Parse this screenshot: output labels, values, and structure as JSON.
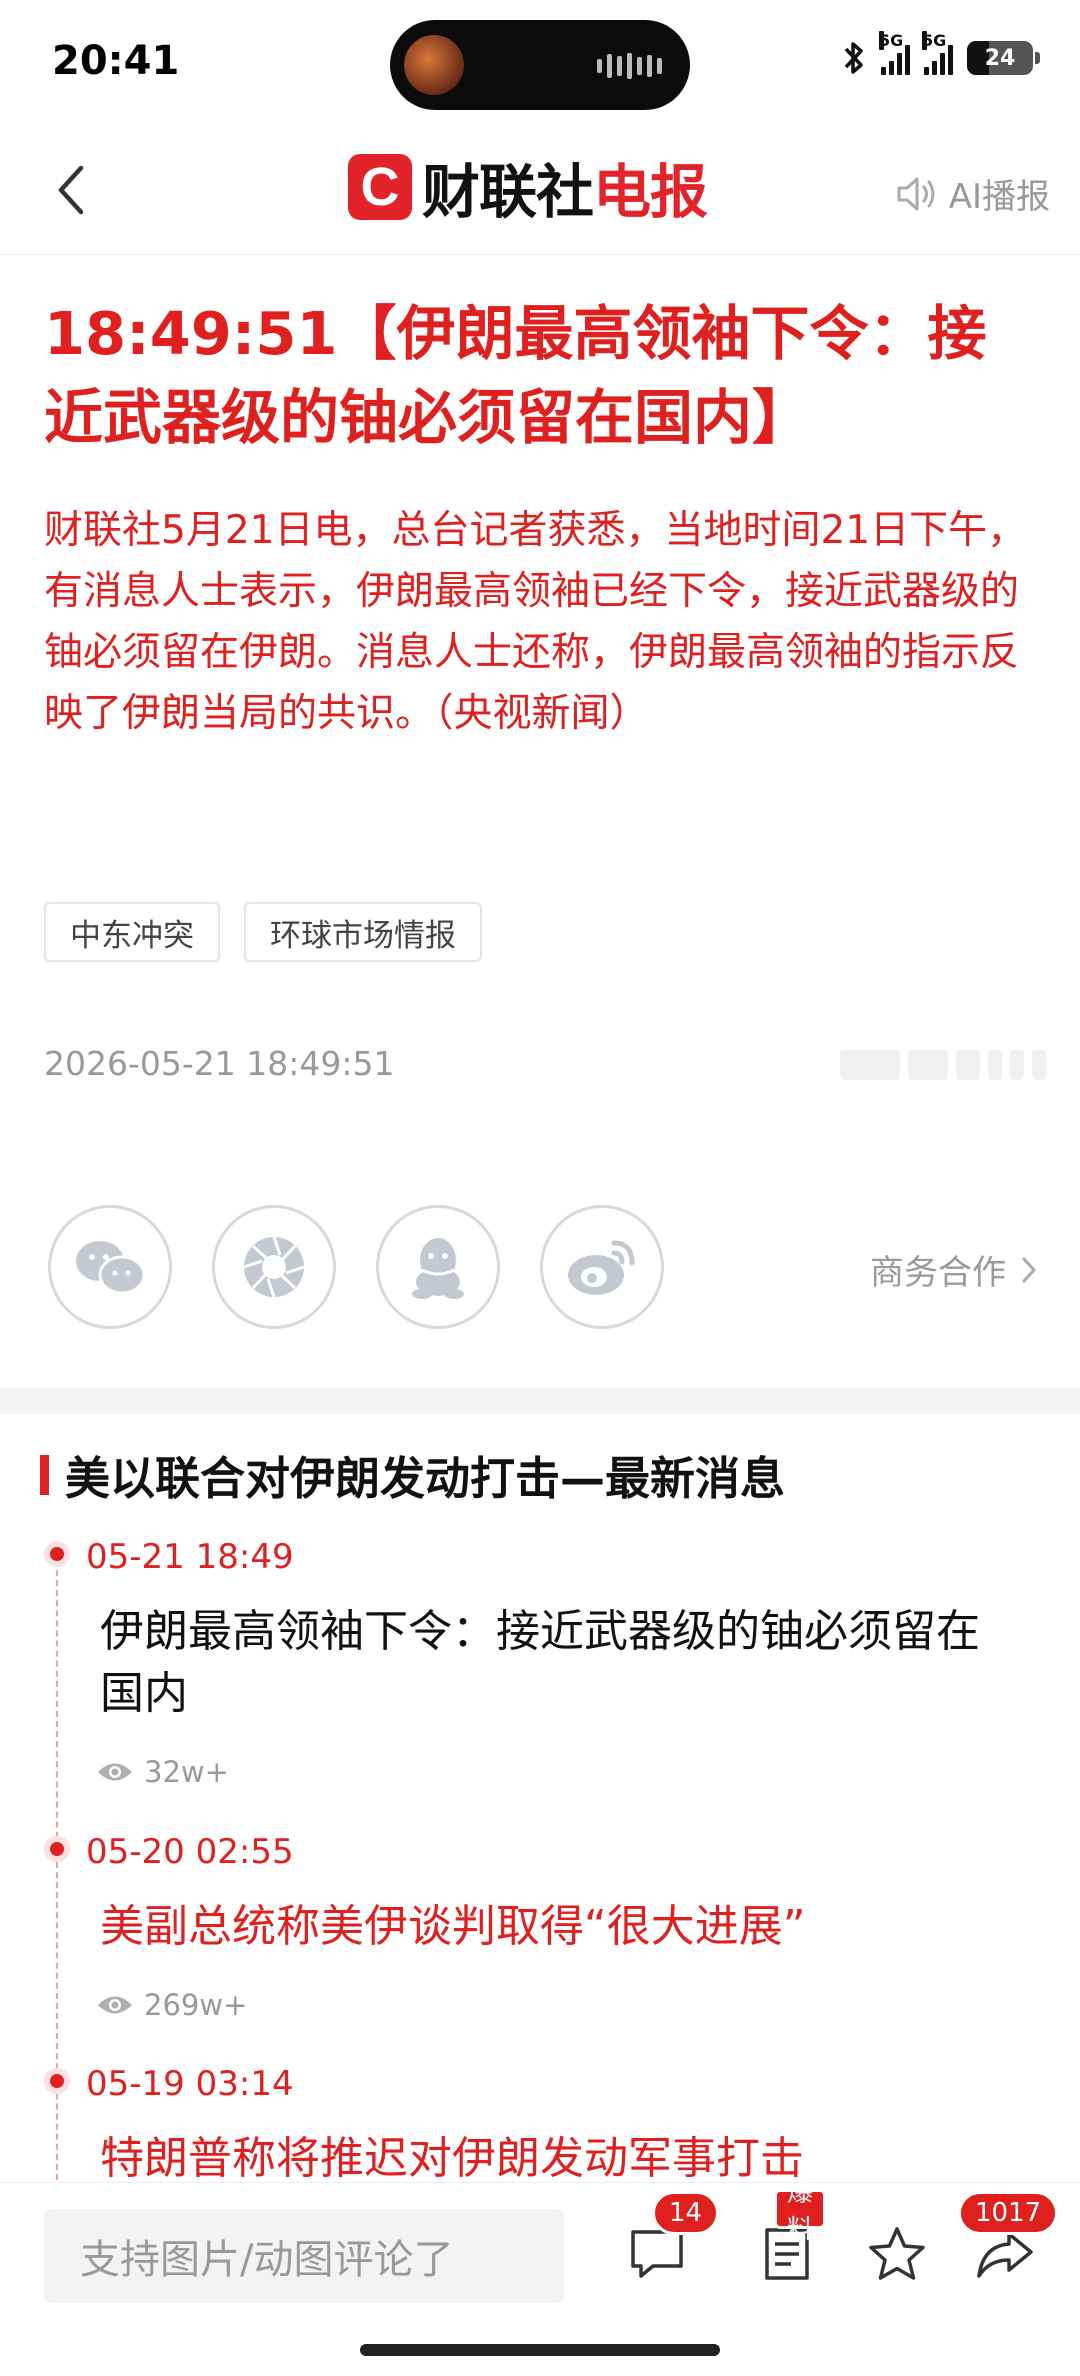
{
  "status_bar": {
    "time": "20:41",
    "network_1": "5G",
    "network_2": "5G",
    "battery": "24"
  },
  "navbar": {
    "brand_logo_letter": "C",
    "brand_name_part1": "财联社",
    "brand_name_part2": "电报",
    "ai_broadcast_label": "AI播报"
  },
  "article": {
    "headline": "18:49:51【伊朗最高领袖下令：接近武器级的铀必须留在国内】",
    "body": "财联社5月21日电，总台记者获悉，当地时间21日下午，有消息人士表示，伊朗最高领袖已经下令，接近武器级的铀必须留在伊朗。消息人士还称，伊朗最高领袖的指示反映了伊朗当局的共识。（央视新闻）",
    "tags": [
      "中东冲突",
      "环球市场情报"
    ],
    "timestamp": "2026-05-21 18:49:51"
  },
  "share": {
    "business_label": "商务合作"
  },
  "timeline": {
    "title": "美以联合对伊朗发动打击—最新消息",
    "items": [
      {
        "time": "05-21 18:49",
        "title": "伊朗最高领袖下令：接近武器级的铀必须留在国内",
        "views": "32w+"
      },
      {
        "time": "05-20 02:55",
        "title": "美副总统称美伊谈判取得“很大进展”",
        "views": "269w+"
      },
      {
        "time": "05-19 03:14",
        "title": "特朗普称将推迟对伊朗发动军事打击"
      }
    ]
  },
  "bottom_bar": {
    "comment_placeholder": "支持图片/动图评论了",
    "comment_count": "14",
    "report_label": "爆料",
    "share_count": "1017"
  },
  "colors": {
    "accent": "#e0201f",
    "brand": "#e2242a",
    "muted": "#999999"
  }
}
